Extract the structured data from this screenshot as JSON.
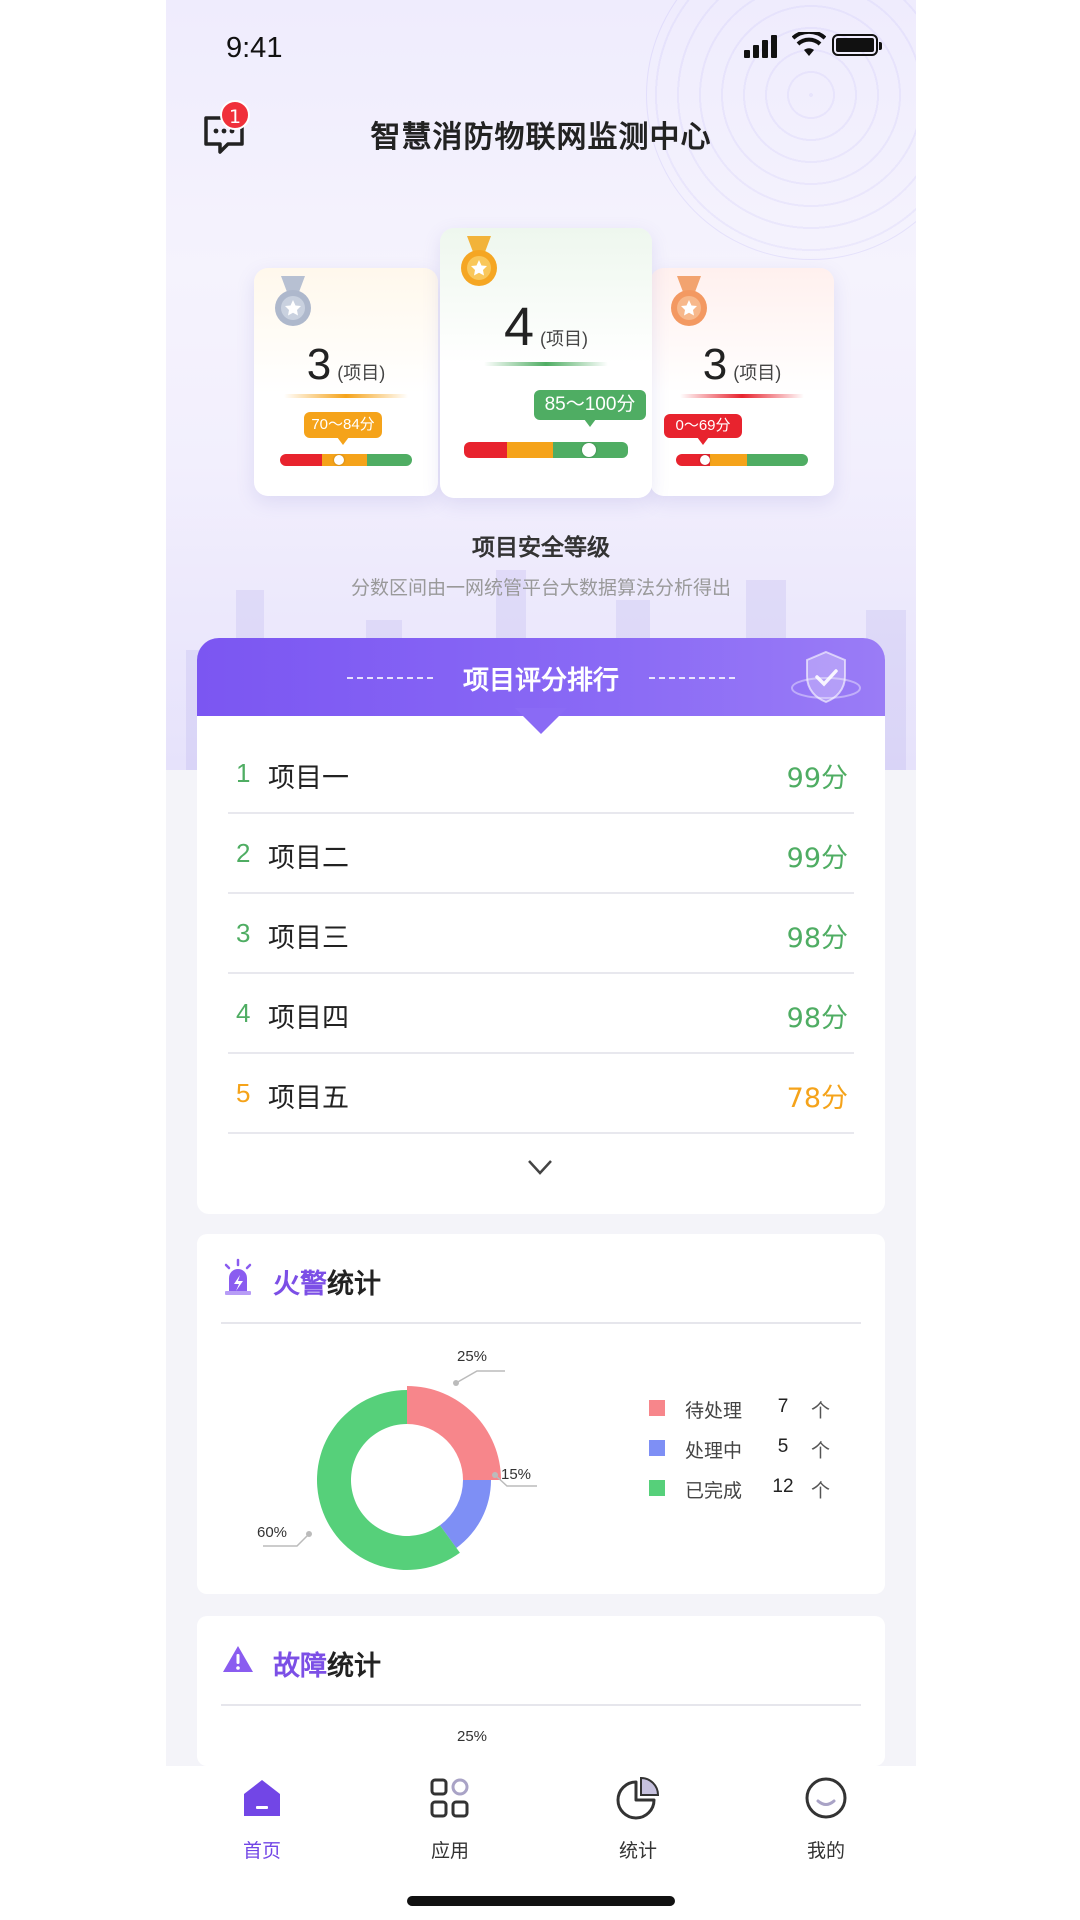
{
  "status_bar": {
    "time": "9:41"
  },
  "header": {
    "title": "智慧消防物联网监测中心",
    "message_badge": "1"
  },
  "levels": {
    "left": {
      "count": "3",
      "unit": "(项目)",
      "range": "70～84分",
      "color": "#f5a31a",
      "medal": "silver-medal-icon",
      "fill_fraction": 0.47
    },
    "center": {
      "count": "4",
      "unit": "(项目)",
      "range": "85～100分",
      "color": "#4fad63",
      "medal": "gold-medal-icon",
      "fill_fraction": 0.77
    },
    "right": {
      "count": "3",
      "unit": "(项目)",
      "range": "0～69分",
      "color": "#e8232e",
      "medal": "bronze-medal-icon",
      "fill_fraction": 0.22
    }
  },
  "level_section": {
    "title": "项目安全等级",
    "subtitle": "分数区间由一网统管平台大数据算法分析得出"
  },
  "ranking": {
    "title": "项目评分排行",
    "rows": [
      {
        "no": "1",
        "name": "项目一",
        "score": "99分",
        "color": "#4fad63"
      },
      {
        "no": "2",
        "name": "项目二",
        "score": "99分",
        "color": "#4fad63"
      },
      {
        "no": "3",
        "name": "项目三",
        "score": "98分",
        "color": "#4fad63"
      },
      {
        "no": "4",
        "name": "项目四",
        "score": "98分",
        "color": "#4fad63"
      },
      {
        "no": "5",
        "name": "项目五",
        "score": "78分",
        "color": "#f5a31a"
      }
    ]
  },
  "fire_stats": {
    "title_accent": "火警",
    "title_rest": "统计",
    "chart_data": {
      "type": "pie",
      "slices": [
        {
          "label": "待处理",
          "value": 7,
          "percent": "25%",
          "color": "#f7868b"
        },
        {
          "label": "处理中",
          "value": 5,
          "percent": "15%",
          "color": "#7e8ff5"
        },
        {
          "label": "已完成",
          "value": 12,
          "percent": "60%",
          "color": "#56d07a"
        }
      ]
    },
    "legend": [
      {
        "label": "待处理",
        "count": "7",
        "unit": "个"
      },
      {
        "label": "处理中",
        "count": "5",
        "unit": "个"
      },
      {
        "label": "已完成",
        "count": "12",
        "unit": "个"
      }
    ]
  },
  "fault_stats": {
    "title_accent": "故障",
    "title_rest": "统计",
    "first_percent": "25%"
  },
  "tabbar": {
    "accent": "#7246e6",
    "items": [
      {
        "label": "首页",
        "icon": "home-icon",
        "active": true
      },
      {
        "label": "应用",
        "icon": "apps-grid-icon"
      },
      {
        "label": "统计",
        "icon": "pie-chart-icon"
      },
      {
        "label": "我的",
        "icon": "profile-icon"
      }
    ]
  }
}
